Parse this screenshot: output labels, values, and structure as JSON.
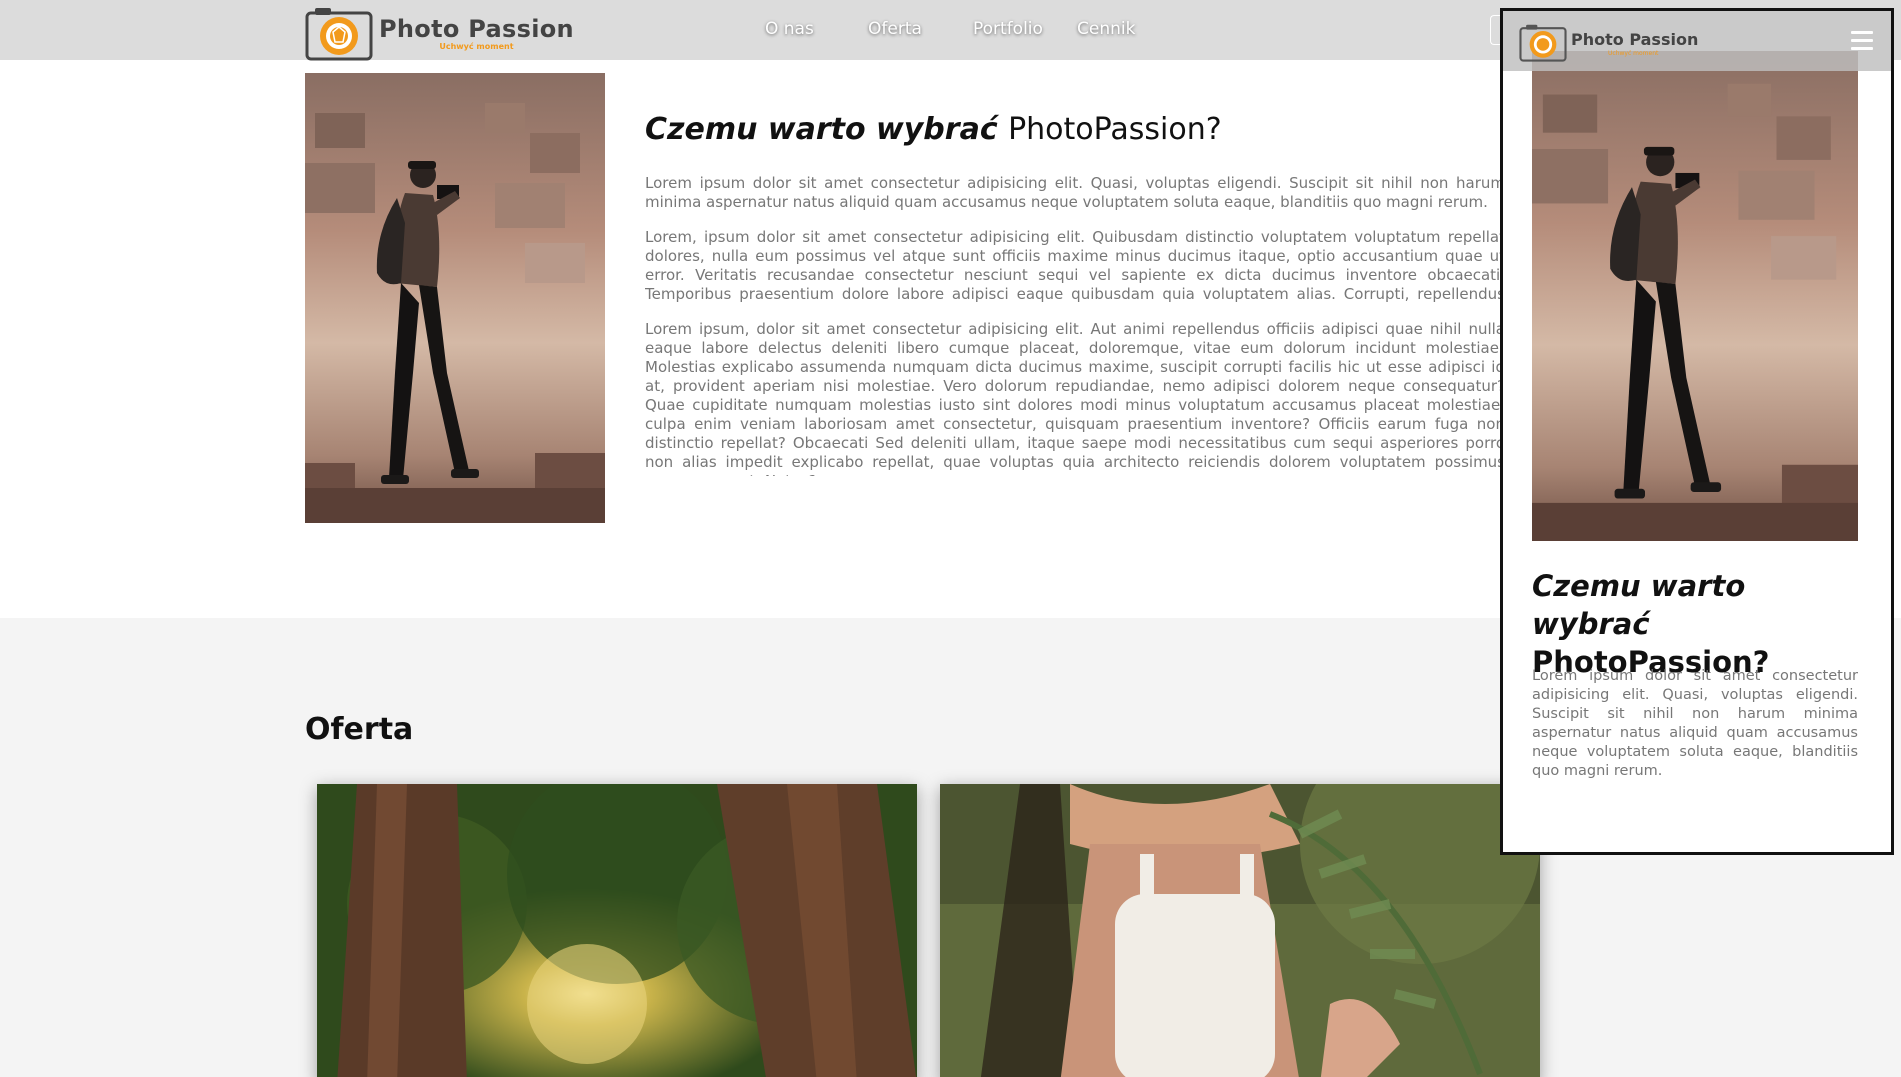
{
  "brand": {
    "name": "Photo Passion",
    "tagline": "Uchwyć moment",
    "accent_color": "#f29a1c",
    "logo_icon": "camera-aperture-icon"
  },
  "nav": {
    "items": [
      {
        "label": "O nas"
      },
      {
        "label": "Oferta"
      },
      {
        "label": "Portfolio"
      },
      {
        "label": "Cennik"
      }
    ]
  },
  "about": {
    "heading_italic": "Czemu warto wybrać",
    "heading_brand": "PhotoPassion?",
    "paragraphs": [
      "Lorem ipsum dolor sit amet consectetur adipisicing elit. Quasi, voluptas eligendi. Suscipit sit nihil non harum minima aspernatur natus aliquid quam accusamus neque voluptatem soluta eaque, blanditiis quo magni rerum.",
      "Lorem, ipsum dolor sit amet consectetur adipisicing elit. Quibusdam distinctio voluptatem voluptatum repellat dolores, nulla eum possimus vel atque sunt officiis maxime minus ducimus itaque, optio accusantium quae ut error. Veritatis recusandae consectetur nesciunt sequi vel sapiente ex dicta ducimus inventore obcaecati. Temporibus praesentium dolore labore adipisci eaque quibusdam quia voluptatem alias. Corrupti, repellendus exercitationem delectus alias labore veniam.",
      "Lorem ipsum, dolor sit amet consectetur adipisicing elit. Aut animi repellendus officiis adipisci quae nihil nulla eaque labore delectus deleniti libero cumque placeat, doloremque, vitae eum dolorum incidunt molestiae! Molestias explicabo assumenda numquam dicta ducimus maxime, suscipit corrupti facilis hic ut esse adipisci id at, provident aperiam nisi molestiae. Vero dolorum repudiandae, nemo adipisci dolorem neque consequatur? Quae cupiditate numquam molestias iusto sint dolores modi minus voluptatum accusamus placeat molestiae, culpa enim veniam laboriosam amet consectetur, quisquam praesentium inventore? Officiis earum fuga non distinctio repellat? Obcaecati Sed deleniti ullam, itaque saepe modi necessitatibus cum sequi asperiores porro non alias impedit explicabo repellat, quae voluptas quia architecto reiciendis dolorem voluptatem possimus magnam amet. Natus?"
    ]
  },
  "oferta": {
    "title": "Oferta"
  },
  "mobile": {
    "menu_icon": "hamburger-menu-icon"
  }
}
